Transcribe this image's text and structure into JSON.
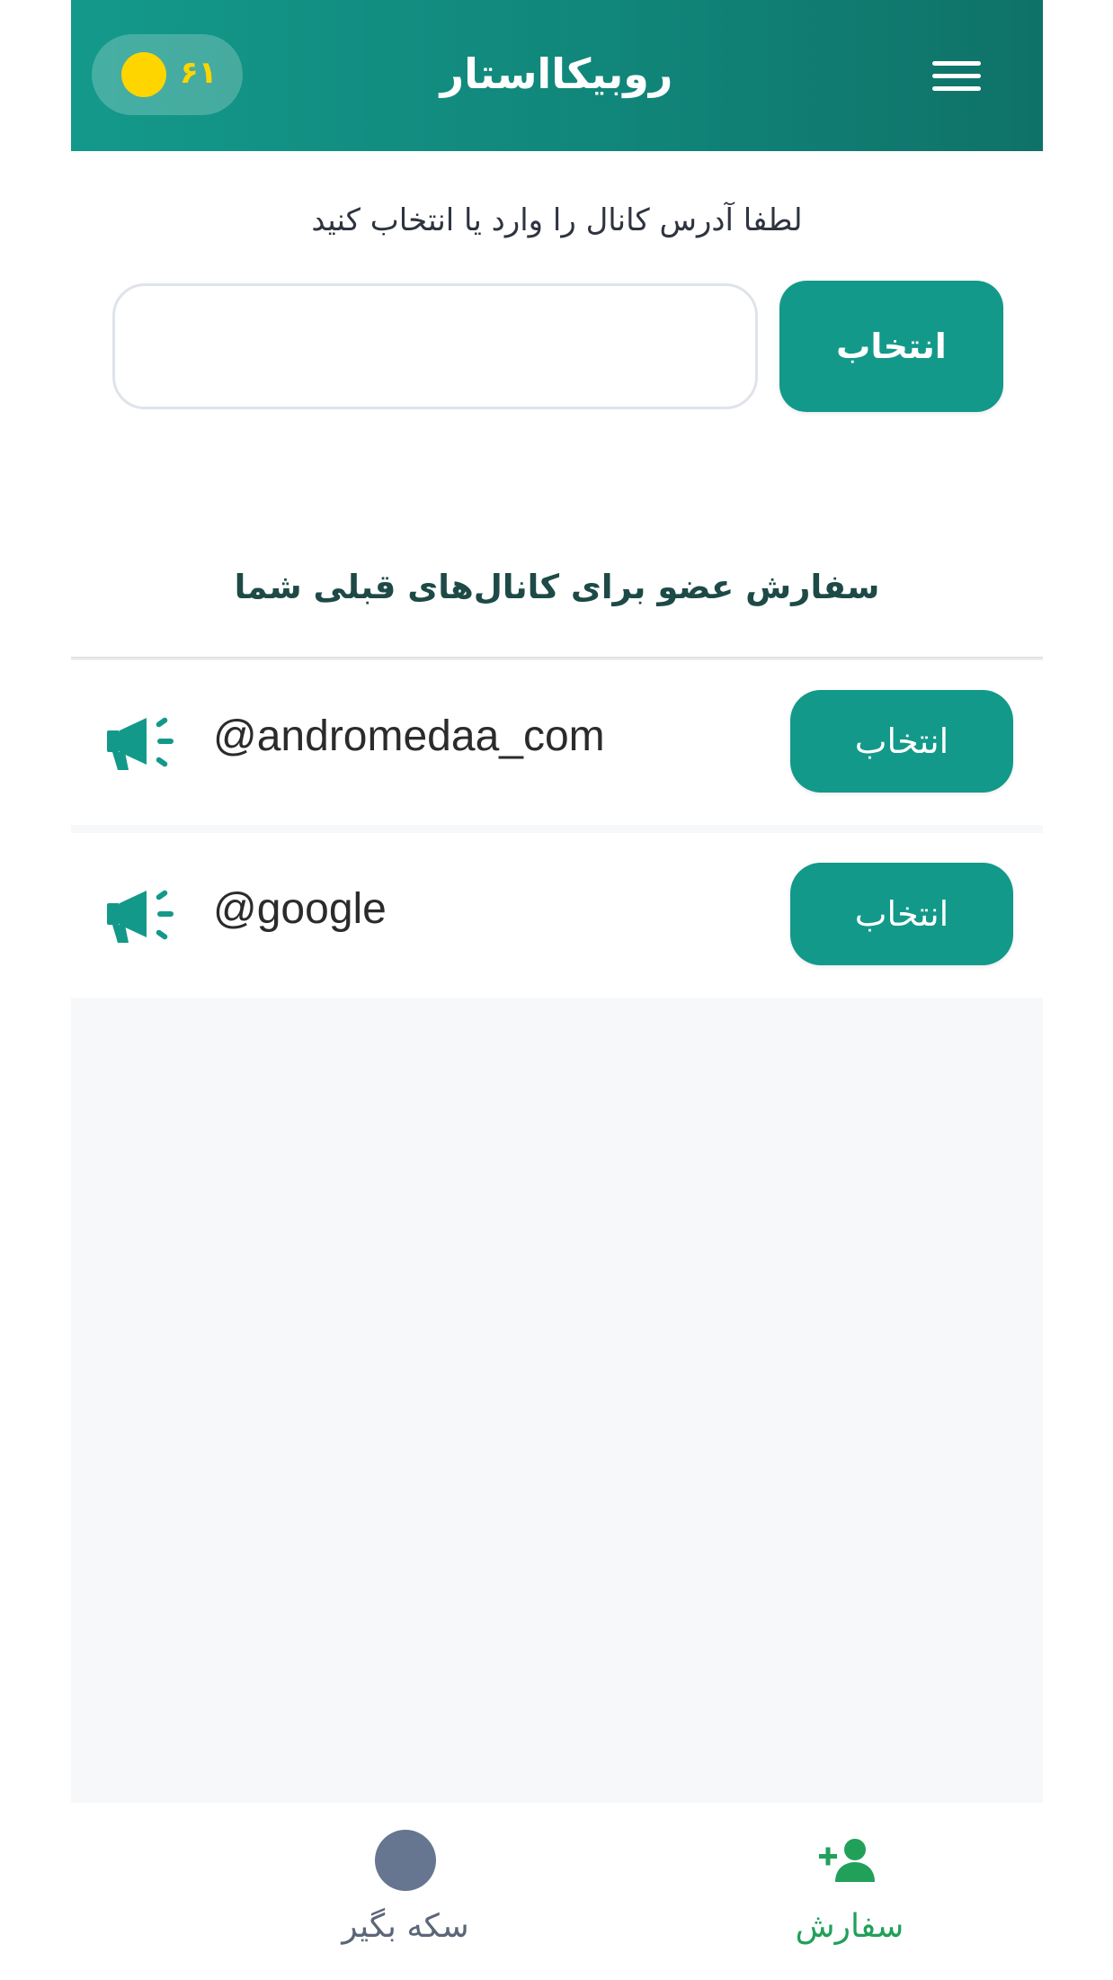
{
  "header": {
    "title": "روبیکااستار",
    "coins": "۶۱",
    "coin_color": "#ffd500",
    "background": "#13998a"
  },
  "form": {
    "prompt": "لطفا آدرس کانال را وارد یا انتخاب کنید",
    "input_value": "",
    "input_placeholder": "",
    "select_label": "انتخاب"
  },
  "previous": {
    "title": "سفارش عضو برای کانال‌های قبلی شما",
    "channels": [
      {
        "name": "@andromedaa_com",
        "select_label": "انتخاب",
        "icon": "megaphone-icon"
      },
      {
        "name": "@google",
        "select_label": "انتخاب",
        "icon": "megaphone-icon"
      }
    ]
  },
  "nav": {
    "coins_label": "سکه بگیر",
    "coins_icon": "coin-icon",
    "order_label": "سفارش",
    "order_icon": "add-user-icon",
    "active_color": "#21a05a"
  }
}
